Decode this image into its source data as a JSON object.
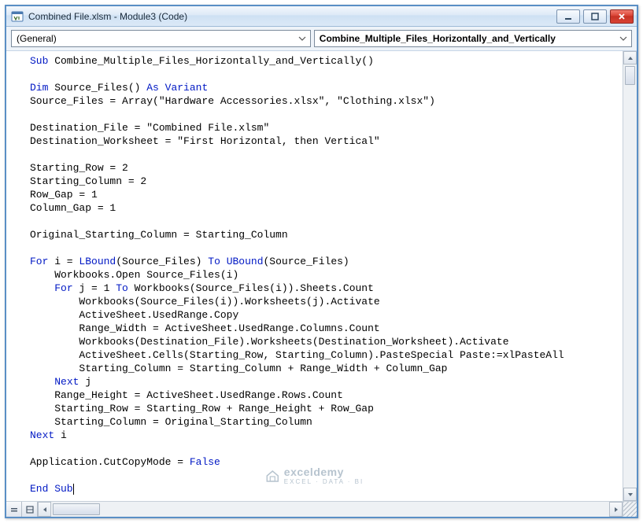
{
  "window": {
    "title": "Combined File.xlsm - Module3 (Code)"
  },
  "dropdowns": {
    "scope": "(General)",
    "procedure": "Combine_Multiple_Files_Horizontally_and_Vertically"
  },
  "code": {
    "l0a": "Sub",
    "l0b": " Combine_Multiple_Files_Horizontally_and_Vertically()",
    "l1a": "Dim",
    "l1b": " Source_Files() ",
    "l1c": "As Variant",
    "l2": "Source_Files = Array(\"Hardware Accessories.xlsx\", \"Clothing.xlsx\")",
    "l3": "Destination_File = \"Combined File.xlsm\"",
    "l4": "Destination_Worksheet = \"First Horizontal, then Vertical\"",
    "l5": "Starting_Row = 2",
    "l6": "Starting_Column = 2",
    "l7": "Row_Gap = 1",
    "l8": "Column_Gap = 1",
    "l9": "Original_Starting_Column = Starting_Column",
    "l10a": "For",
    "l10b": " i = ",
    "l10c": "LBound",
    "l10d": "(Source_Files) ",
    "l10e": "To",
    "l10f": " ",
    "l10g": "UBound",
    "l10h": "(Source_Files)",
    "l11": "    Workbooks.Open Source_Files(i)",
    "l12a": "    ",
    "l12b": "For",
    "l12c": " j = 1 ",
    "l12d": "To",
    "l12e": " Workbooks(Source_Files(i)).Sheets.Count",
    "l13": "        Workbooks(Source_Files(i)).Worksheets(j).Activate",
    "l14": "        ActiveSheet.UsedRange.Copy",
    "l15": "        Range_Width = ActiveSheet.UsedRange.Columns.Count",
    "l16": "        Workbooks(Destination_File).Worksheets(Destination_Worksheet).Activate",
    "l17": "        ActiveSheet.Cells(Starting_Row, Starting_Column).PasteSpecial Paste:=xlPasteAll",
    "l18": "        Starting_Column = Starting_Column + Range_Width + Column_Gap",
    "l19a": "    ",
    "l19b": "Next",
    "l19c": " j",
    "l20": "    Range_Height = ActiveSheet.UsedRange.Rows.Count",
    "l21": "    Starting_Row = Starting_Row + Range_Height + Row_Gap",
    "l22": "    Starting_Column = Original_Starting_Column",
    "l23a": "Next",
    "l23b": " i",
    "l24a": "Application.CutCopyMode = ",
    "l24b": "False",
    "l25": "End Sub"
  },
  "watermark": {
    "brand": "exceldemy",
    "tagline": "EXCEL · DATA · BI"
  }
}
